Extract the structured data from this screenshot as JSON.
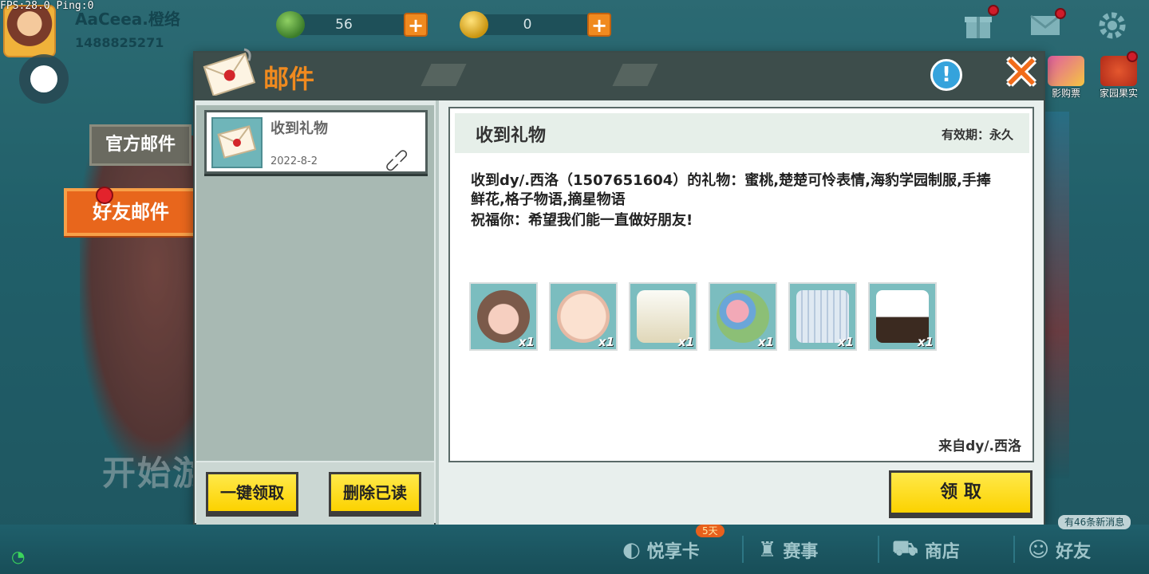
{
  "debug": {
    "fps_text": "FPS:28.0  Ping:0"
  },
  "player": {
    "name": "AaCeea.橙络",
    "id": "1488825271"
  },
  "currencies": [
    {
      "icon": "gem-icon",
      "value": "56"
    },
    {
      "icon": "coin-icon",
      "value": "0"
    }
  ],
  "currency_plus": "+",
  "top_icons": {
    "gift": "gift-icon",
    "mail": "mail-icon",
    "settings": "gear-icon"
  },
  "activities": [
    {
      "label": "影购票"
    },
    {
      "label": "家园果实"
    }
  ],
  "side_tabs": {
    "official": "官方邮件",
    "friend": "好友邮件"
  },
  "background": {
    "start_text": "开始游"
  },
  "mail_window": {
    "title": "邮件",
    "info_label": "!",
    "close_label": "✕"
  },
  "mail_list": [
    {
      "subject": "收到礼物",
      "date": "2022-8-2",
      "has_attachment": true
    }
  ],
  "left_buttons": {
    "claim_all": "一键领取",
    "delete_read": "删除已读"
  },
  "mail_detail": {
    "title": "收到礼物",
    "expiry": "有效期：永久",
    "body_lines": [
      "收到dy/.西洛（1507651604）的礼物：蜜桃,楚楚可怜表情,海豹学园制服,手捧",
      "鲜花,格子物语,摘星物语",
      "祝福你：希望我们能一直做好朋友!"
    ],
    "gifts": [
      {
        "name": "蜜桃",
        "qty": "x1"
      },
      {
        "name": "楚楚可怜表情",
        "qty": "x1"
      },
      {
        "name": "海豹学园制服",
        "qty": "x1"
      },
      {
        "name": "手捧鲜花",
        "qty": "x1"
      },
      {
        "name": "格子物语",
        "qty": "x1"
      },
      {
        "name": "摘星物语",
        "qty": "x1"
      }
    ],
    "sender": "来自dy/.西洛",
    "claim_button": "领 取"
  },
  "bottom_nav": [
    {
      "label": "悦享卡",
      "icon": "pig-icon"
    },
    {
      "label": "赛事",
      "icon": "trophy-icon"
    },
    {
      "label": "商店",
      "icon": "cart-icon"
    },
    {
      "label": "好友",
      "icon": "friend-icon"
    }
  ],
  "badges": {
    "pass_days": "5天",
    "new_messages": "有46条新消息"
  },
  "colors": {
    "accent_orange": "#f08a1f",
    "button_yellow": "#fcd200",
    "header_dark": "#3d4d4b"
  }
}
